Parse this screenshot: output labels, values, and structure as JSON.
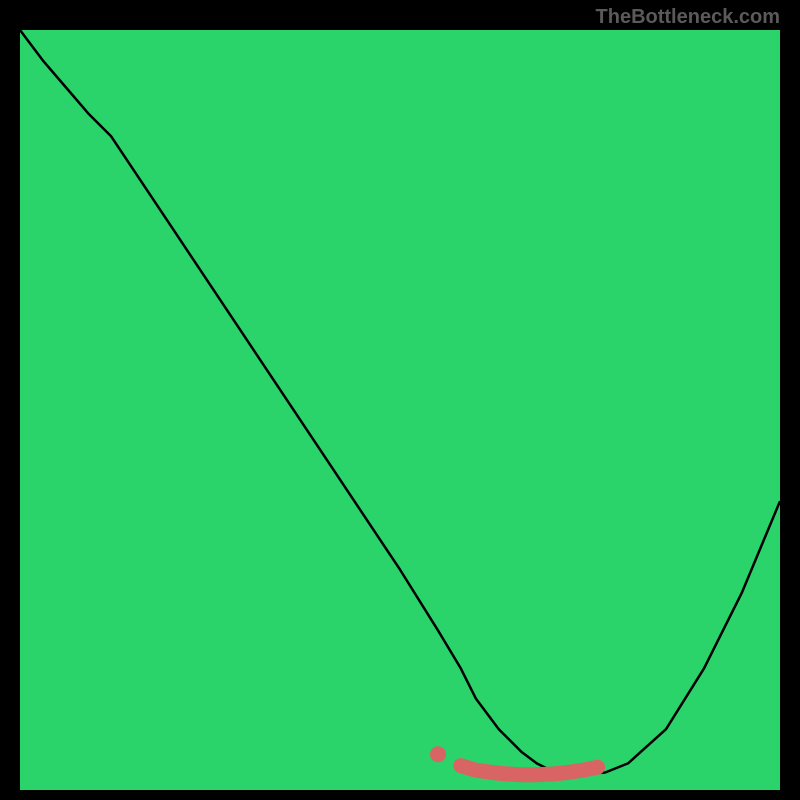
{
  "watermark": "TheBottleneck.com",
  "chart_data": {
    "type": "line",
    "title": "",
    "xlabel": "",
    "ylabel": "",
    "xlim": [
      0,
      100
    ],
    "ylim": [
      0,
      100
    ],
    "series": [
      {
        "name": "curve",
        "color": "#000000",
        "x": [
          0,
          3,
          6,
          9,
          12,
          20,
          30,
          40,
          50,
          55,
          58,
          60,
          63,
          66,
          68,
          70,
          73,
          77,
          80,
          85,
          90,
          95,
          100
        ],
        "y": [
          100,
          96,
          92.5,
          89,
          86,
          74,
          59,
          44,
          29,
          21,
          16,
          12,
          8,
          5,
          3.5,
          2.5,
          2,
          2.3,
          3.5,
          8,
          16,
          26,
          38
        ]
      },
      {
        "name": "highlight",
        "color": "#d86464",
        "x": [
          58,
          60,
          63,
          66,
          68,
          70,
          72,
          74,
          76
        ],
        "y": [
          3.2,
          2.6,
          2.2,
          2.0,
          2.0,
          2.1,
          2.3,
          2.6,
          3.0
        ]
      }
    ],
    "bands": [
      {
        "from": 0.0,
        "to": 0.035,
        "color": "#2bd36b"
      },
      {
        "from": 0.035,
        "to": 0.06,
        "color": "#79e66a"
      },
      {
        "from": 0.06,
        "to": 0.11,
        "color": "#d4f56a"
      },
      {
        "from": 0.11,
        "to": 0.17,
        "color": "#f6f76b"
      },
      {
        "from": 0.17,
        "to": 0.3,
        "color": "#fce94f"
      },
      {
        "from": 0.3,
        "to": 0.42,
        "color": "#fdd43f"
      },
      {
        "from": 0.42,
        "to": 0.55,
        "color": "#feb43a"
      },
      {
        "from": 0.55,
        "to": 0.68,
        "color": "#ff8f3d"
      },
      {
        "from": 0.68,
        "to": 0.8,
        "color": "#ff6a43"
      },
      {
        "from": 0.8,
        "to": 0.9,
        "color": "#ff4a4a"
      },
      {
        "from": 0.9,
        "to": 0.96,
        "color": "#ff3355"
      },
      {
        "from": 0.96,
        "to": 1.0,
        "color": "#ff2a5d"
      }
    ]
  }
}
